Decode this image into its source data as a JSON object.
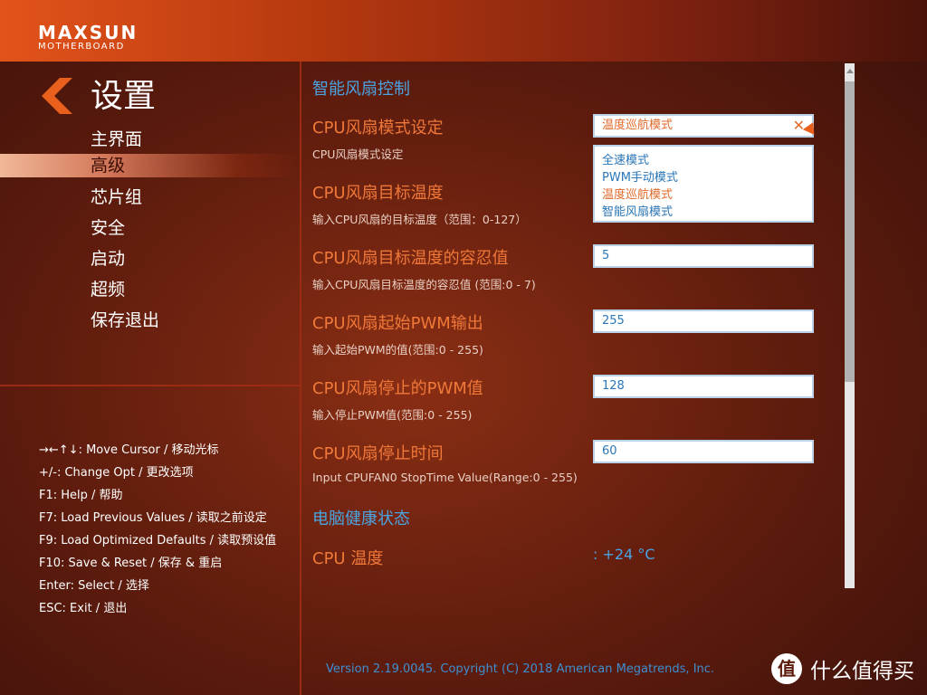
{
  "brand": {
    "logo_main": "MAXSUN",
    "logo_sub": "MOTHERBOARD"
  },
  "section": {
    "title": "设置"
  },
  "menu": [
    {
      "label": "主界面",
      "active": false
    },
    {
      "label": "高级",
      "active": true
    },
    {
      "label": "芯片组",
      "active": false
    },
    {
      "label": "安全",
      "active": false
    },
    {
      "label": "启动",
      "active": false
    },
    {
      "label": "超频",
      "active": false
    },
    {
      "label": "保存退出",
      "active": false
    }
  ],
  "help": [
    "→←↑↓: Move Cursor / 移动光标",
    "+/-: Change Opt / 更改选项",
    "F1: Help / 帮助",
    "F7: Load Previous Values / 读取之前设定",
    "F9: Load Optimized Defaults / 读取预设值",
    "F10: Save & Reset / 保存 & 重启",
    "Enter: Select / 选择",
    "ESC: Exit / 退出"
  ],
  "main": {
    "smart_fan_heading": "智能风扇控制",
    "mode": {
      "title": "CPU风扇模式设定",
      "desc": "CPU风扇模式设定",
      "value": "温度巡航模式",
      "options": [
        "全速模式",
        "PWM手动模式",
        "温度巡航模式",
        "智能风扇模式"
      ],
      "selected_index": 2
    },
    "target_temp": {
      "title": "CPU风扇目标温度",
      "desc": "输入CPU风扇的目标温度（范围：0-127）"
    },
    "tolerance": {
      "title": "CPU风扇目标温度的容忍值",
      "desc": "输入CPU风扇目标温度的容忍值 (范围:0 - 7)",
      "value": "5"
    },
    "start_pwm": {
      "title": "CPU风扇起始PWM输出",
      "desc": "输入起始PWM的值(范围:0 - 255)",
      "value": "255"
    },
    "stop_pwm": {
      "title": "CPU风扇停止的PWM值",
      "desc": "输入停止PWM值(范围:0 - 255)",
      "value": "128"
    },
    "stop_time": {
      "title": "CPU风扇停止时间",
      "desc": "Input CPUFAN0 StopTime Value(Range:0 - 255)",
      "value": "60"
    },
    "health_heading": "电脑健康状态",
    "cpu_temp": {
      "label": "CPU 温度",
      "value": ": +24 °C"
    }
  },
  "footer": {
    "version": "Version 2.19.0045. Copyright (C) 2018 American Megatrends, Inc."
  },
  "watermark": {
    "icon_text": "值",
    "text": "什么值得买"
  },
  "colors": {
    "accent_orange": "#f07838",
    "heading_blue": "#4aa3e0",
    "field_border": "#b9d2e8",
    "topbar_orange": "#e2531a"
  }
}
